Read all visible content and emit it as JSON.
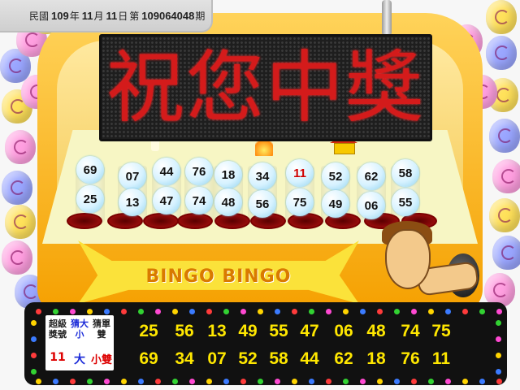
{
  "info": {
    "prefix": "民國",
    "year": "109",
    "year_unit": "年",
    "month": "11",
    "month_unit": "月",
    "day": "11",
    "day_unit": "日",
    "draw_prefix": "第",
    "draw_number": "109064048",
    "draw_suffix": "期"
  },
  "board": {
    "message": "祝您中獎"
  },
  "balls": {
    "top": [
      "69",
      "07",
      "44",
      "76",
      "18",
      "34",
      "11",
      "52",
      "62",
      "58"
    ],
    "bottom": [
      "25",
      "13",
      "47",
      "74",
      "48",
      "56",
      "75",
      "49",
      "06",
      "55"
    ],
    "special_value": "11"
  },
  "banner": {
    "text": "BINGO BINGO"
  },
  "legend": {
    "super_number_label": "超級獎號",
    "big_small_label": "猜大小",
    "odd_even_label": "猜單雙",
    "super_number_value": "11",
    "big_small_value": "大",
    "odd_even_value": "小雙"
  },
  "results": {
    "row1": [
      "25",
      "56",
      "13",
      "49",
      "55",
      "47",
      "06",
      "48",
      "74",
      "75"
    ],
    "row2": [
      "69",
      "34",
      "07",
      "52",
      "58",
      "44",
      "62",
      "18",
      "76",
      "11"
    ]
  },
  "colors": {
    "led_red": "#d41b1b",
    "result_yellow": "#ffe700",
    "machine_orange": "#f5a000",
    "special_red": "#d00000",
    "bigsmall_blue": "#1a2ad8"
  }
}
